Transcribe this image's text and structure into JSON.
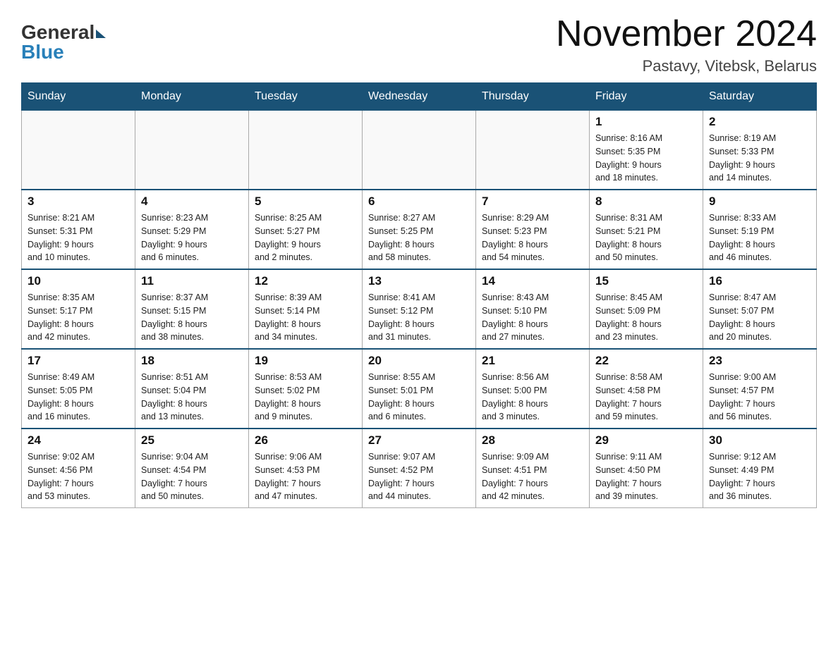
{
  "header": {
    "logo": {
      "general": "General",
      "blue": "Blue"
    },
    "title": "November 2024",
    "location": "Pastavy, Vitebsk, Belarus"
  },
  "days_of_week": [
    "Sunday",
    "Monday",
    "Tuesday",
    "Wednesday",
    "Thursday",
    "Friday",
    "Saturday"
  ],
  "weeks": [
    [
      {
        "day": "",
        "info": ""
      },
      {
        "day": "",
        "info": ""
      },
      {
        "day": "",
        "info": ""
      },
      {
        "day": "",
        "info": ""
      },
      {
        "day": "",
        "info": ""
      },
      {
        "day": "1",
        "info": "Sunrise: 8:16 AM\nSunset: 5:35 PM\nDaylight: 9 hours\nand 18 minutes."
      },
      {
        "day": "2",
        "info": "Sunrise: 8:19 AM\nSunset: 5:33 PM\nDaylight: 9 hours\nand 14 minutes."
      }
    ],
    [
      {
        "day": "3",
        "info": "Sunrise: 8:21 AM\nSunset: 5:31 PM\nDaylight: 9 hours\nand 10 minutes."
      },
      {
        "day": "4",
        "info": "Sunrise: 8:23 AM\nSunset: 5:29 PM\nDaylight: 9 hours\nand 6 minutes."
      },
      {
        "day": "5",
        "info": "Sunrise: 8:25 AM\nSunset: 5:27 PM\nDaylight: 9 hours\nand 2 minutes."
      },
      {
        "day": "6",
        "info": "Sunrise: 8:27 AM\nSunset: 5:25 PM\nDaylight: 8 hours\nand 58 minutes."
      },
      {
        "day": "7",
        "info": "Sunrise: 8:29 AM\nSunset: 5:23 PM\nDaylight: 8 hours\nand 54 minutes."
      },
      {
        "day": "8",
        "info": "Sunrise: 8:31 AM\nSunset: 5:21 PM\nDaylight: 8 hours\nand 50 minutes."
      },
      {
        "day": "9",
        "info": "Sunrise: 8:33 AM\nSunset: 5:19 PM\nDaylight: 8 hours\nand 46 minutes."
      }
    ],
    [
      {
        "day": "10",
        "info": "Sunrise: 8:35 AM\nSunset: 5:17 PM\nDaylight: 8 hours\nand 42 minutes."
      },
      {
        "day": "11",
        "info": "Sunrise: 8:37 AM\nSunset: 5:15 PM\nDaylight: 8 hours\nand 38 minutes."
      },
      {
        "day": "12",
        "info": "Sunrise: 8:39 AM\nSunset: 5:14 PM\nDaylight: 8 hours\nand 34 minutes."
      },
      {
        "day": "13",
        "info": "Sunrise: 8:41 AM\nSunset: 5:12 PM\nDaylight: 8 hours\nand 31 minutes."
      },
      {
        "day": "14",
        "info": "Sunrise: 8:43 AM\nSunset: 5:10 PM\nDaylight: 8 hours\nand 27 minutes."
      },
      {
        "day": "15",
        "info": "Sunrise: 8:45 AM\nSunset: 5:09 PM\nDaylight: 8 hours\nand 23 minutes."
      },
      {
        "day": "16",
        "info": "Sunrise: 8:47 AM\nSunset: 5:07 PM\nDaylight: 8 hours\nand 20 minutes."
      }
    ],
    [
      {
        "day": "17",
        "info": "Sunrise: 8:49 AM\nSunset: 5:05 PM\nDaylight: 8 hours\nand 16 minutes."
      },
      {
        "day": "18",
        "info": "Sunrise: 8:51 AM\nSunset: 5:04 PM\nDaylight: 8 hours\nand 13 minutes."
      },
      {
        "day": "19",
        "info": "Sunrise: 8:53 AM\nSunset: 5:02 PM\nDaylight: 8 hours\nand 9 minutes."
      },
      {
        "day": "20",
        "info": "Sunrise: 8:55 AM\nSunset: 5:01 PM\nDaylight: 8 hours\nand 6 minutes."
      },
      {
        "day": "21",
        "info": "Sunrise: 8:56 AM\nSunset: 5:00 PM\nDaylight: 8 hours\nand 3 minutes."
      },
      {
        "day": "22",
        "info": "Sunrise: 8:58 AM\nSunset: 4:58 PM\nDaylight: 7 hours\nand 59 minutes."
      },
      {
        "day": "23",
        "info": "Sunrise: 9:00 AM\nSunset: 4:57 PM\nDaylight: 7 hours\nand 56 minutes."
      }
    ],
    [
      {
        "day": "24",
        "info": "Sunrise: 9:02 AM\nSunset: 4:56 PM\nDaylight: 7 hours\nand 53 minutes."
      },
      {
        "day": "25",
        "info": "Sunrise: 9:04 AM\nSunset: 4:54 PM\nDaylight: 7 hours\nand 50 minutes."
      },
      {
        "day": "26",
        "info": "Sunrise: 9:06 AM\nSunset: 4:53 PM\nDaylight: 7 hours\nand 47 minutes."
      },
      {
        "day": "27",
        "info": "Sunrise: 9:07 AM\nSunset: 4:52 PM\nDaylight: 7 hours\nand 44 minutes."
      },
      {
        "day": "28",
        "info": "Sunrise: 9:09 AM\nSunset: 4:51 PM\nDaylight: 7 hours\nand 42 minutes."
      },
      {
        "day": "29",
        "info": "Sunrise: 9:11 AM\nSunset: 4:50 PM\nDaylight: 7 hours\nand 39 minutes."
      },
      {
        "day": "30",
        "info": "Sunrise: 9:12 AM\nSunset: 4:49 PM\nDaylight: 7 hours\nand 36 minutes."
      }
    ]
  ]
}
